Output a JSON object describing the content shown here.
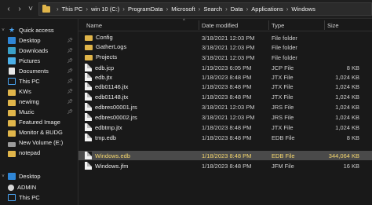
{
  "address_bar": {
    "crumbs": [
      "This PC",
      "win 10 (C:)",
      "ProgramData",
      "Microsoft",
      "Search",
      "Data",
      "Applications",
      "Windows"
    ]
  },
  "sidebar": {
    "items": [
      {
        "label": "Quick access",
        "icon": "star-icon",
        "expand": "v",
        "pinned": false
      },
      {
        "label": "Desktop",
        "icon": "desktop-icon",
        "expand": "",
        "pinned": true
      },
      {
        "label": "Downloads",
        "icon": "download-icon",
        "expand": "",
        "pinned": true
      },
      {
        "label": "Pictures",
        "icon": "pictures-icon",
        "expand": "",
        "pinned": true
      },
      {
        "label": "Documents",
        "icon": "documents-icon",
        "expand": "",
        "pinned": true
      },
      {
        "label": "This PC",
        "icon": "computer-icon",
        "expand": "",
        "pinned": true
      },
      {
        "label": "KWs",
        "icon": "folder-icon",
        "expand": "",
        "pinned": true
      },
      {
        "label": "newimg",
        "icon": "folder-icon",
        "expand": "",
        "pinned": true
      },
      {
        "label": "Muzic",
        "icon": "folder-icon",
        "expand": "",
        "pinned": true
      },
      {
        "label": "Featured Image",
        "icon": "folder-icon",
        "expand": "",
        "pinned": false
      },
      {
        "label": "Monitor & BUDG",
        "icon": "folder-icon",
        "expand": "",
        "pinned": false
      },
      {
        "label": "New Volume (E:)",
        "icon": "drive-icon",
        "expand": "",
        "pinned": false
      },
      {
        "label": "notepad",
        "icon": "folder-icon",
        "expand": "",
        "pinned": false
      },
      {
        "label": "Desktop",
        "icon": "desktop-icon",
        "expand": "v",
        "pinned": false
      },
      {
        "label": "ADMIN",
        "icon": "user-icon",
        "expand": "",
        "pinned": false
      },
      {
        "label": "This PC",
        "icon": "computer-icon",
        "expand": "",
        "pinned": false
      }
    ]
  },
  "columns": {
    "name": "Name",
    "date": "Date modified",
    "type": "Type",
    "size": "Size"
  },
  "files": [
    {
      "name": "Config",
      "date": "3/18/2021 12:03 PM",
      "type": "File folder",
      "size": "",
      "kind": "folder",
      "selected": false
    },
    {
      "name": "GatherLogs",
      "date": "3/18/2021 12:03 PM",
      "type": "File folder",
      "size": "",
      "kind": "folder",
      "selected": false
    },
    {
      "name": "Projects",
      "date": "3/18/2021 12:03 PM",
      "type": "File folder",
      "size": "",
      "kind": "folder",
      "selected": false
    },
    {
      "name": "edb.jcp",
      "date": "1/19/2023 6:05 PM",
      "type": "JCP File",
      "size": "8 KB",
      "kind": "file",
      "selected": false
    },
    {
      "name": "edb.jtx",
      "date": "1/18/2023 8:48 PM",
      "type": "JTX File",
      "size": "1,024 KB",
      "kind": "file",
      "selected": false
    },
    {
      "name": "edb01146.jtx",
      "date": "1/18/2023 8:48 PM",
      "type": "JTX File",
      "size": "1,024 KB",
      "kind": "file",
      "selected": false
    },
    {
      "name": "edb01148.jtx",
      "date": "1/18/2023 8:48 PM",
      "type": "JTX File",
      "size": "1,024 KB",
      "kind": "file",
      "selected": false
    },
    {
      "name": "edbres00001.jrs",
      "date": "3/18/2021 12:03 PM",
      "type": "JRS File",
      "size": "1,024 KB",
      "kind": "file",
      "selected": false
    },
    {
      "name": "edbres00002.jrs",
      "date": "3/18/2021 12:03 PM",
      "type": "JRS File",
      "size": "1,024 KB",
      "kind": "file",
      "selected": false
    },
    {
      "name": "edbtmp.jtx",
      "date": "1/18/2023 8:48 PM",
      "type": "JTX File",
      "size": "1,024 KB",
      "kind": "file",
      "selected": false
    },
    {
      "name": "tmp.edb",
      "date": "1/18/2023 8:48 PM",
      "type": "EDB File",
      "size": "8 KB",
      "kind": "file",
      "selected": false
    },
    {
      "name": "Windows.edb",
      "date": "1/18/2023 8:48 PM",
      "type": "EDB File",
      "size": "344,064 KB",
      "kind": "file",
      "selected": true
    },
    {
      "name": "Windows.jfm",
      "date": "1/18/2023 8:48 PM",
      "type": "JFM File",
      "size": "16 KB",
      "kind": "file",
      "selected": false
    }
  ],
  "colors": {
    "background": "#191919",
    "folder": "#e0b54a",
    "selected_row": "#4a4a4a",
    "selected_text": "#f5d76e"
  }
}
